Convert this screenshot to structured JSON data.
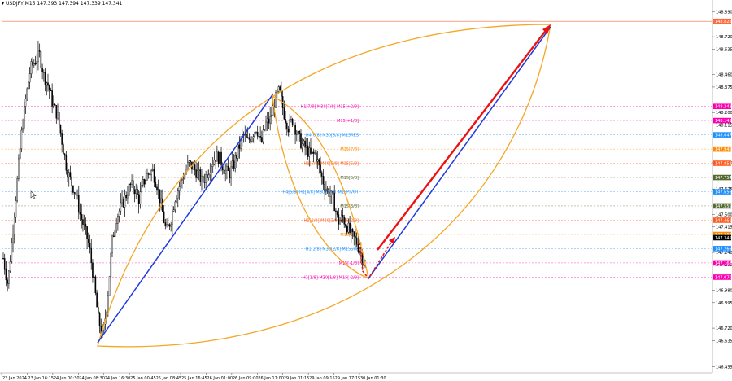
{
  "header": {
    "symbol_line": "USDJPY,M15",
    "ohlc": "147.393 147.394 147.339 147.341"
  },
  "colors": {
    "background": "#ffffff",
    "candle": "#000000",
    "trend_blue": "#1e3adf",
    "arc_orange": "#f5a623",
    "arrow_red": "#ee1111",
    "grid_line": "#c8c8c8"
  },
  "chart_data": {
    "type": "candlestick",
    "symbol": "USDJPY",
    "timeframe": "M15",
    "ylim": [
      146.43,
      148.95
    ],
    "x_tick_labels": [
      "23 Jan 2024",
      "23 Jan 16:15",
      "24 Jan 00:30",
      "24 Jan 08:30",
      "24 Jan 16:30",
      "25 Jan 00:45",
      "25 Jan 08:45",
      "25 Jan 16:45",
      "26 Jan 01:00",
      "26 Jan 09:00",
      "26 Jan 17:00",
      "29 Jan 01:15",
      "29 Jan 09:15",
      "29 Jan 17:15",
      "30 Jan 01:30"
    ],
    "y_tick_labels": [
      "148.890",
      "148.720",
      "148.635",
      "148.460",
      "148.375",
      "148.200",
      "148.115",
      "147.855",
      "147.675",
      "147.500",
      "147.415",
      "147.240",
      "147.155",
      "146.980",
      "146.895",
      "146.720",
      "146.635",
      "146.455"
    ],
    "price_tags": [
      {
        "value": "148.826",
        "price": 148.826,
        "color": "#ff6a3d"
      },
      {
        "value": "148.242",
        "price": 148.242,
        "color": "#ff00b0"
      },
      {
        "value": "148.145",
        "price": 148.145,
        "color": "#ff00b0"
      },
      {
        "value": "148.047",
        "price": 148.047,
        "color": "#1e90ff"
      },
      {
        "value": "147.949",
        "price": 147.949,
        "color": "#ff8a00"
      },
      {
        "value": "147.852",
        "price": 147.852,
        "color": "#ff5a1f"
      },
      {
        "value": "147.754",
        "price": 147.754,
        "color": "#556b2f"
      },
      {
        "value": "147.656",
        "price": 147.656,
        "color": "#1e90ff"
      },
      {
        "value": "147.559",
        "price": 147.559,
        "color": "#556b2f"
      },
      {
        "value": "147.461",
        "price": 147.461,
        "color": "#ff5a1f"
      },
      {
        "value": "147.363",
        "price": 147.363,
        "color": "#ff8a00"
      },
      {
        "value": "147.341",
        "price": 147.341,
        "color": "#000000"
      },
      {
        "value": "147.266",
        "price": 147.266,
        "color": "#1e90ff"
      },
      {
        "value": "147.168",
        "price": 147.168,
        "color": "#ff00b0"
      },
      {
        "value": "147.070",
        "price": 147.07,
        "color": "#ff00b0"
      }
    ],
    "murrey_labels": [
      {
        "text": "H1[7/8] M30[7/8] M15[+2/8]",
        "price": 148.242,
        "color": "#ff00b0"
      },
      {
        "text": "M15[+1/8]",
        "price": 148.145,
        "color": "#ff00b0"
      },
      {
        "text": "H4[6/8] M30[6/8] M15RES",
        "price": 148.047,
        "color": "#1e90ff"
      },
      {
        "text": "M15[7/8]",
        "price": 147.949,
        "color": "#ff8a00"
      },
      {
        "text": "H1[5/8] M30[5/8] M15[6/8]",
        "price": 147.852,
        "color": "#ff5a1f"
      },
      {
        "text": "M15[5/8]",
        "price": 147.754,
        "color": "#556b2f"
      },
      {
        "text": "H4[5/8] H1[4/8] M30PIVOT M15PIVOT",
        "price": 147.656,
        "color": "#1e90ff"
      },
      {
        "text": "M15[3/8]",
        "price": 147.559,
        "color": "#556b2f"
      },
      {
        "text": "H1[3/8] M30[3/8] M15[2/8]",
        "price": 147.461,
        "color": "#ff5a1f"
      },
      {
        "text": "M15[1/8]",
        "price": 147.363,
        "color": "#ff8a00"
      },
      {
        "text": "H1[2/8] M30[2/8] M15SUP",
        "price": 147.266,
        "color": "#1e90ff"
      },
      {
        "text": "M15[-1/8]",
        "price": 147.168,
        "color": "#ff00b0"
      },
      {
        "text": "H1[1/8] M30[1/8] M15[-2/8]",
        "price": 147.07,
        "color": "#ff00b0"
      }
    ],
    "close_series": [
      147.2,
      147.02,
      147.35,
      147.7,
      148.05,
      148.3,
      148.5,
      148.55,
      148.6,
      148.45,
      148.38,
      148.25,
      148.18,
      148.0,
      147.82,
      147.72,
      147.65,
      147.5,
      147.4,
      147.28,
      147.05,
      146.78,
      146.66,
      146.9,
      147.3,
      147.48,
      147.55,
      147.62,
      147.7,
      147.68,
      147.6,
      147.72,
      147.78,
      147.8,
      147.7,
      147.55,
      147.38,
      147.46,
      147.62,
      147.7,
      147.78,
      147.85,
      147.82,
      147.78,
      147.72,
      147.78,
      147.85,
      147.9,
      147.88,
      147.8,
      147.78,
      147.85,
      147.95,
      148.05,
      148.0,
      148.05,
      148.1,
      147.98,
      148.12,
      148.15,
      148.28,
      148.35,
      148.2,
      148.1,
      148.15,
      148.05,
      147.98,
      147.95,
      147.9,
      147.92,
      147.8,
      147.7,
      147.65,
      147.6,
      147.45,
      147.48,
      147.42,
      147.35,
      147.32,
      147.24,
      147.14
    ]
  }
}
